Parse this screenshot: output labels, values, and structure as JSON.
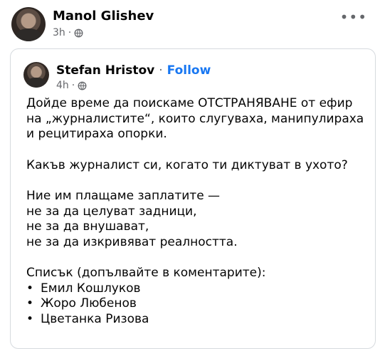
{
  "outer_post": {
    "author": "Manol Glishev",
    "time": "3h",
    "separator": "·",
    "audience_icon": "globe-icon",
    "more_icon": "more-horizontal-icon"
  },
  "shared_post": {
    "author": "Stefan Hristov",
    "separator": "·",
    "follow_label": "Follow",
    "time": "4h",
    "audience_icon": "globe-icon",
    "lines": {
      "l1": "Дойде време да поискаме ОТСТРАНЯВАНЕ от ефир",
      "l2": "на „журналистите“, които слугуваха, манипулираха",
      "l3": "и рецитираха опорки.",
      "l4": "Какъв журналист си, когато ти диктуват в ухото?",
      "l5": "Ние им плащаме заплатите —",
      "l6": "не за да целуват задници,",
      "l7": "не за да внушават,",
      "l8": "не за да изкривяват реалността.",
      "l9": "Списък (допълвайте в коментарите):"
    },
    "list": [
      "Емил Кошлуков",
      "Жоро Любенов",
      "Цветанка Ризова"
    ],
    "bullet": "•"
  }
}
